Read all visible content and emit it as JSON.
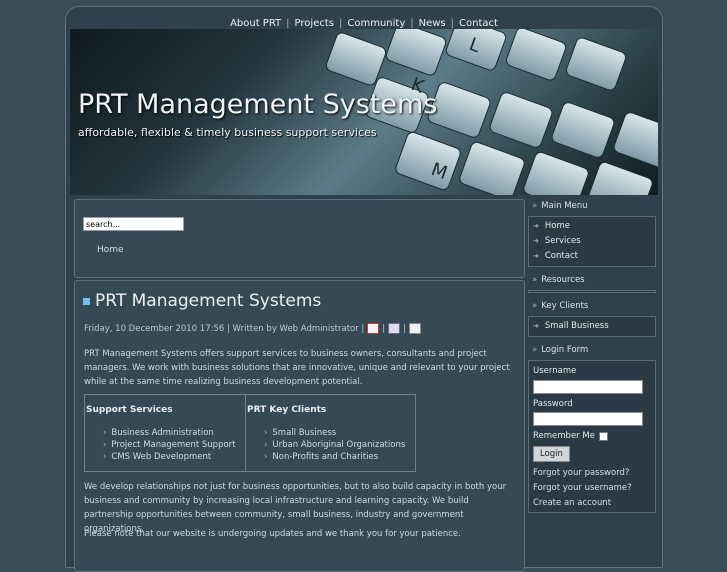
{
  "topnav": {
    "items": [
      "About PRT",
      "Projects",
      "Community",
      "News",
      "Contact"
    ]
  },
  "banner": {
    "title": "PRT Management Systems",
    "subtitle": "affordable, flexible & timely business support services",
    "image_icon": "keyboard-keys"
  },
  "search": {
    "value": "search...",
    "breadcrumb_home": "Home"
  },
  "article": {
    "title": "PRT Management Systems",
    "meta": "Friday, 10 December 2010 17:56 | Written by Web Administrator |",
    "sep1": "|",
    "sep2": "|",
    "icons": [
      "pdf-icon",
      "print-icon",
      "email-icon"
    ],
    "intro": "PRT Management Systems offers support services to business owners, consultants and project managers.  We work with business solutions that are innovative, unique and relevant to your project while at the same time realizing business development potential.",
    "services_heading": "Support Services",
    "services": [
      "Business Administration",
      "Project Management Support",
      "CMS Web Development"
    ],
    "clients_heading": "PRT Key Clients",
    "clients": [
      "Small Business",
      "Urban Aboriginal Organizations",
      "Non-Profits and Charities"
    ],
    "body": "We develop relationships not just for business opportunities, but to also build capacity in both your business and community by increasing local infrastructure and learning capacity. We build partnership opportunities between community, small business, industry and government organizations.",
    "note": "Please note that our website is undergoing updates and we thank you for your patience."
  },
  "sidebar": {
    "main_menu_title": "Main Menu",
    "main_menu": [
      "Home",
      "Services",
      "Contact"
    ],
    "resources_title": "Resources",
    "key_clients_title": "Key Clients",
    "key_clients": [
      "Small Business"
    ],
    "login_title": "Login Form",
    "username_label": "Username",
    "password_label": "Password",
    "remember_label": "Remember Me",
    "login_button": "Login",
    "forgot_password": "Forgot your password?",
    "forgot_username": "Forgot your username?",
    "create_account": "Create an account"
  },
  "colors": {
    "background": "#3a4c58",
    "panel": "#364a55",
    "accent": "#6ec3e8"
  }
}
